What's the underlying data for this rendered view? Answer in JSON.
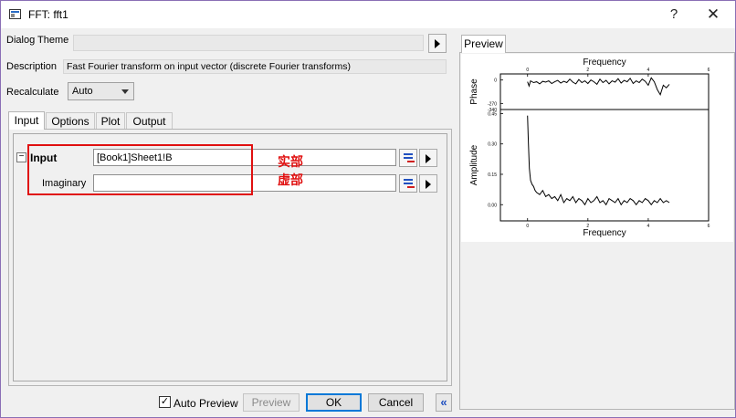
{
  "window": {
    "title": "FFT: fft1",
    "help_glyph": "?",
    "close_glyph": "✕"
  },
  "dialog_theme": {
    "label": "Dialog Theme",
    "value": ""
  },
  "description": {
    "label": "Description",
    "value": "Fast Fourier transform on input vector (discrete Fourier transforms)"
  },
  "recalculate": {
    "label": "Recalculate",
    "value": "Auto"
  },
  "tabs": [
    {
      "label": "Input",
      "active": true
    },
    {
      "label": "Options",
      "active": false
    },
    {
      "label": "Plot",
      "active": false
    },
    {
      "label": "Output",
      "active": false
    }
  ],
  "input_group": {
    "toggle": "−",
    "title": "Input",
    "input_value": "[Book1]Sheet1!B",
    "imaginary_label": "Imaginary",
    "imaginary_value": ""
  },
  "annotations": {
    "real_part": "实部",
    "imaginary_part": "虚部",
    "highlight_color": "#e01010"
  },
  "bottom": {
    "auto_preview_label": "Auto Preview",
    "auto_preview_checked": true,
    "check_glyph": "✓",
    "preview_label": "Preview",
    "ok_label": "OK",
    "cancel_label": "Cancel",
    "collapse_glyph": "«"
  },
  "preview_panel": {
    "tab_label": "Preview"
  },
  "chart_data": [
    {
      "type": "line",
      "title": "",
      "xlabel": "Frequency",
      "ylabel": "Phase",
      "xlim": [
        -0.9,
        6
      ],
      "ylim": [
        -340,
        70
      ],
      "xticks": [
        "0",
        "2",
        "4",
        "6"
      ],
      "yticks": [
        "0",
        "-270",
        "-340"
      ],
      "x_axis_position": "top",
      "series": [
        {
          "x": [
            0,
            0.05,
            0.1,
            0.2,
            0.3,
            0.4,
            0.5,
            0.6,
            0.7,
            0.8,
            0.9,
            1.0,
            1.1,
            1.2,
            1.3,
            1.4,
            1.5,
            1.6,
            1.7,
            1.8,
            1.9,
            2.0,
            2.1,
            2.2,
            2.3,
            2.4,
            2.5,
            2.6,
            2.7,
            2.8,
            2.9,
            3.0,
            3.1,
            3.2,
            3.3,
            3.4,
            3.5,
            3.6,
            3.7,
            3.8,
            3.9,
            4.0,
            4.1,
            4.2,
            4.3,
            4.4,
            4.5,
            4.6,
            4.7
          ],
          "y": [
            -20,
            -70,
            -10,
            -30,
            -20,
            -45,
            -15,
            -25,
            -10,
            -40,
            -20,
            -5,
            -35,
            -15,
            -30,
            10,
            -25,
            -45,
            5,
            -30,
            -10,
            -40,
            0,
            -20,
            -50,
            10,
            -30,
            -5,
            -45,
            -10,
            -25,
            15,
            -35,
            -5,
            -20,
            20,
            -40,
            -10,
            -30,
            10,
            -15,
            -60,
            25,
            -20,
            -110,
            -170,
            -60,
            -90,
            -50
          ]
        }
      ]
    },
    {
      "type": "line",
      "title": "",
      "xlabel": "Frequency",
      "ylabel": "Amplitude",
      "xlim": [
        -0.9,
        6
      ],
      "ylim": [
        -0.08,
        0.47
      ],
      "xticks": [
        "0",
        "2",
        "4",
        "6"
      ],
      "yticks": [
        "0.00",
        "0.15",
        "0.30",
        "0.45"
      ],
      "series": [
        {
          "x": [
            0.0,
            0.03,
            0.06,
            0.1,
            0.15,
            0.2,
            0.25,
            0.3,
            0.4,
            0.5,
            0.6,
            0.7,
            0.8,
            0.9,
            1.0,
            1.1,
            1.2,
            1.3,
            1.4,
            1.5,
            1.6,
            1.7,
            1.8,
            1.9,
            2.0,
            2.1,
            2.2,
            2.3,
            2.4,
            2.5,
            2.6,
            2.7,
            2.8,
            2.9,
            3.0,
            3.1,
            3.2,
            3.3,
            3.4,
            3.5,
            3.6,
            3.7,
            3.8,
            3.9,
            4.0,
            4.1,
            4.2,
            4.3,
            4.4,
            4.5,
            4.6,
            4.7
          ],
          "y": [
            0.44,
            0.3,
            0.18,
            0.12,
            0.1,
            0.09,
            0.07,
            0.06,
            0.05,
            0.07,
            0.04,
            0.05,
            0.03,
            0.04,
            0.02,
            0.05,
            0.01,
            0.03,
            0.02,
            0.04,
            0.01,
            0.03,
            0.02,
            0.0,
            0.03,
            0.01,
            0.02,
            0.04,
            0.01,
            0.02,
            0.0,
            0.03,
            0.02,
            0.01,
            0.03,
            0.0,
            0.02,
            0.01,
            0.03,
            0.02,
            0.0,
            0.02,
            0.01,
            0.03,
            0.02,
            0.0,
            0.02,
            0.01,
            0.03,
            0.01,
            0.02,
            0.01
          ]
        }
      ]
    }
  ]
}
